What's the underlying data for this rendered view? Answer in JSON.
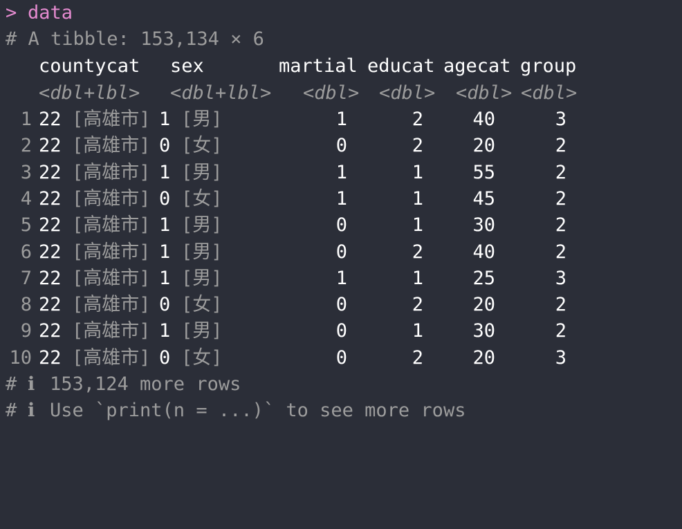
{
  "prompt": {
    "symbol": ">",
    "command": "data"
  },
  "summary": "# A tibble: 153,134 × 6",
  "columns": [
    {
      "name": "countycat",
      "type": "<dbl+lbl>"
    },
    {
      "name": "sex",
      "type": "<dbl+lbl>"
    },
    {
      "name": "martial",
      "type": "<dbl>"
    },
    {
      "name": "educat",
      "type": "<dbl>"
    },
    {
      "name": "agecat",
      "type": "<dbl>"
    },
    {
      "name": "group",
      "type": "<dbl>"
    }
  ],
  "rows": [
    {
      "idx": "1",
      "county_val": "22",
      "county_lbl": "[高雄市]",
      "sex_val": "1",
      "sex_lbl": "[男]",
      "martial": "1",
      "educat": "2",
      "agecat": "40",
      "group": "3"
    },
    {
      "idx": "2",
      "county_val": "22",
      "county_lbl": "[高雄市]",
      "sex_val": "0",
      "sex_lbl": "[女]",
      "martial": "0",
      "educat": "2",
      "agecat": "20",
      "group": "2"
    },
    {
      "idx": "3",
      "county_val": "22",
      "county_lbl": "[高雄市]",
      "sex_val": "1",
      "sex_lbl": "[男]",
      "martial": "1",
      "educat": "1",
      "agecat": "55",
      "group": "2"
    },
    {
      "idx": "4",
      "county_val": "22",
      "county_lbl": "[高雄市]",
      "sex_val": "0",
      "sex_lbl": "[女]",
      "martial": "1",
      "educat": "1",
      "agecat": "45",
      "group": "2"
    },
    {
      "idx": "5",
      "county_val": "22",
      "county_lbl": "[高雄市]",
      "sex_val": "1",
      "sex_lbl": "[男]",
      "martial": "0",
      "educat": "1",
      "agecat": "30",
      "group": "2"
    },
    {
      "idx": "6",
      "county_val": "22",
      "county_lbl": "[高雄市]",
      "sex_val": "1",
      "sex_lbl": "[男]",
      "martial": "0",
      "educat": "2",
      "agecat": "40",
      "group": "2"
    },
    {
      "idx": "7",
      "county_val": "22",
      "county_lbl": "[高雄市]",
      "sex_val": "1",
      "sex_lbl": "[男]",
      "martial": "1",
      "educat": "1",
      "agecat": "25",
      "group": "3"
    },
    {
      "idx": "8",
      "county_val": "22",
      "county_lbl": "[高雄市]",
      "sex_val": "0",
      "sex_lbl": "[女]",
      "martial": "0",
      "educat": "2",
      "agecat": "20",
      "group": "2"
    },
    {
      "idx": "9",
      "county_val": "22",
      "county_lbl": "[高雄市]",
      "sex_val": "1",
      "sex_lbl": "[男]",
      "martial": "0",
      "educat": "1",
      "agecat": "30",
      "group": "2"
    },
    {
      "idx": "10",
      "county_val": "22",
      "county_lbl": "[高雄市]",
      "sex_val": "0",
      "sex_lbl": "[女]",
      "martial": "0",
      "educat": "2",
      "agecat": "20",
      "group": "3"
    }
  ],
  "footer": [
    {
      "hash": "#",
      "info": "ℹ",
      "text": "153,124 more rows"
    },
    {
      "hash": "#",
      "info": "ℹ",
      "text": "Use `print(n = ...)` to see more rows"
    }
  ],
  "colors": {
    "background": "#2b2e38",
    "prompt": "#e58bd0",
    "dim": "#9c9c9c",
    "text": "#ffffff"
  }
}
